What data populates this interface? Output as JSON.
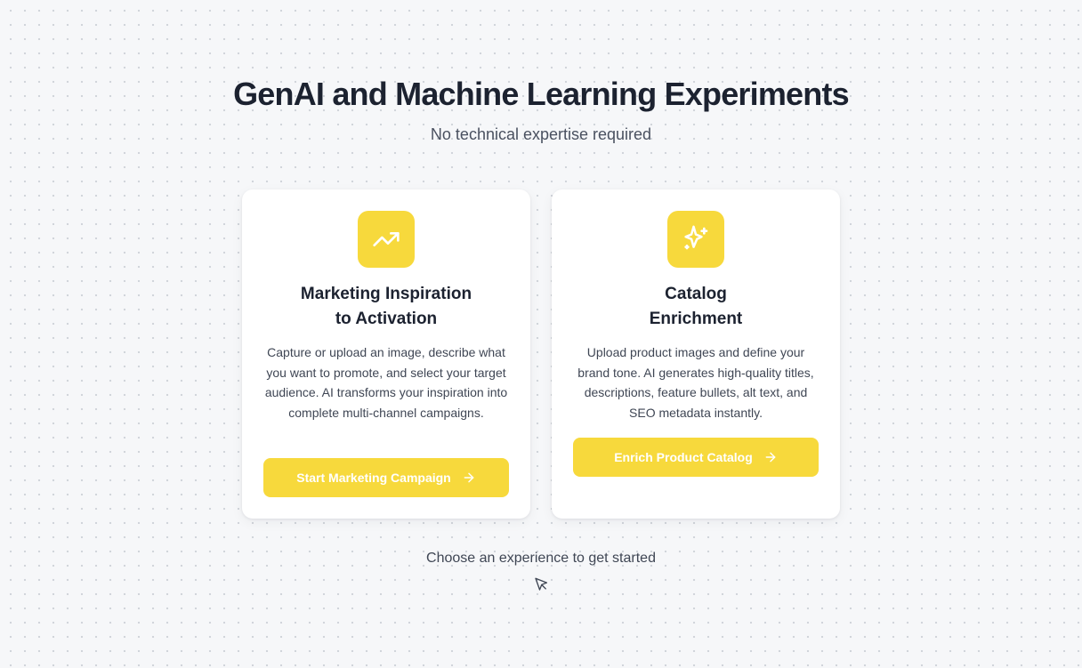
{
  "header": {
    "title": "GenAI and Machine Learning Experiments",
    "subtitle": "No technical expertise required"
  },
  "cards": [
    {
      "icon": "trending-up-icon",
      "title_line1": "Marketing Inspiration",
      "title_line2": "to Activation",
      "description": "Capture or upload an image, describe what you want to promote, and select your target audience. AI transforms your inspiration into complete multi-channel campaigns.",
      "button_label": "Start Marketing Campaign"
    },
    {
      "icon": "sparkles-icon",
      "title_line1": "Catalog",
      "title_line2": "Enrichment",
      "description": "Upload product images and define your brand tone. AI generates high-quality titles, descriptions, feature bullets, alt text, and SEO metadata instantly.",
      "button_label": "Enrich Product Catalog"
    }
  ],
  "footer": {
    "prompt": "Choose an experience to get started",
    "icon": "mouse-pointer-icon"
  },
  "colors": {
    "accent": "#f7d93c",
    "background": "#f6f7f9",
    "card": "#ffffff",
    "text": "#1c2230"
  }
}
